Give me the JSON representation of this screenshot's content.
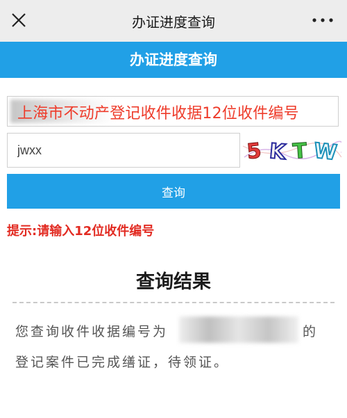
{
  "topbar": {
    "title": "办证进度查询",
    "close_icon": "close-icon",
    "more_icon": "more-dots-icon"
  },
  "header": {
    "title": "办证进度查询",
    "color": "#21a0e6"
  },
  "form": {
    "record_label": "上海市不动产登记收件收据12位收件编号",
    "code_value": "jwxx",
    "captcha_text": "5KTW",
    "search_label": "查询",
    "hint": "提示:请输入12位收件编号"
  },
  "result": {
    "title": "查询结果",
    "line1_prefix": "您查询收件收据编号为",
    "line1_suffix": "的",
    "line2": "登记案件已完成缮证，待领证。"
  },
  "colors": {
    "accent": "#21a0e6",
    "alert": "#e22b22"
  }
}
